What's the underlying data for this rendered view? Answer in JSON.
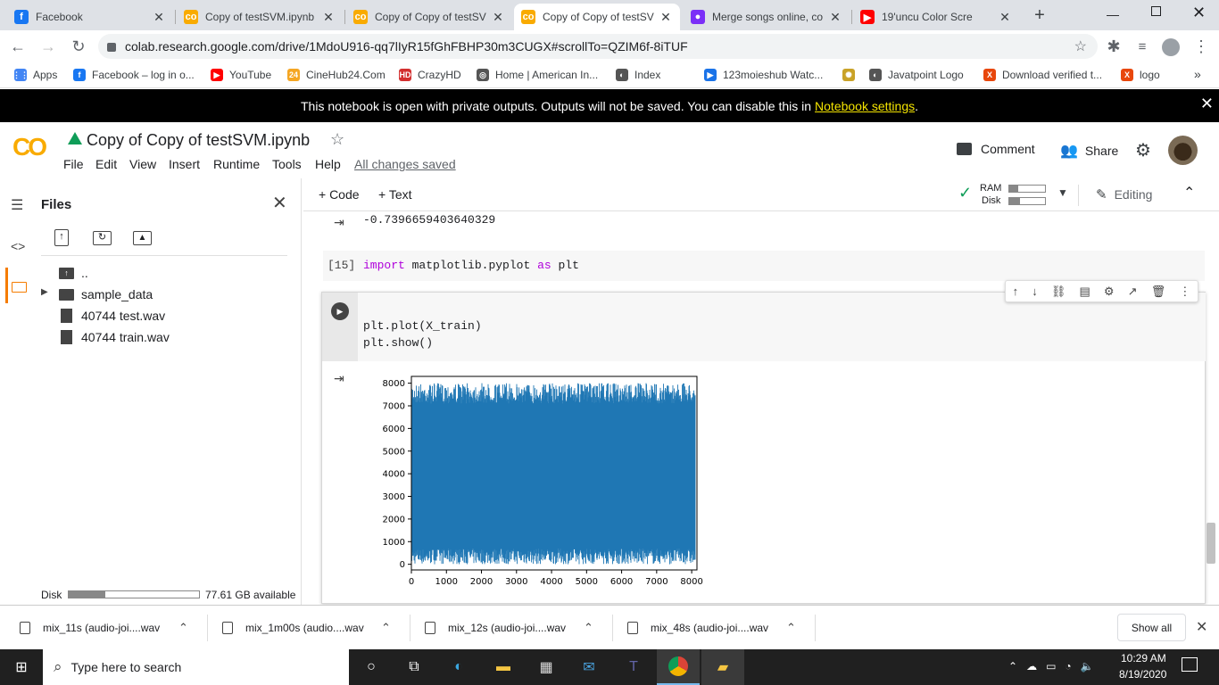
{
  "browser": {
    "tabs": [
      {
        "title": "Facebook",
        "icon": "facebook-icon",
        "color": "#1877f2",
        "glyph": "f"
      },
      {
        "title": "Copy of testSVM.ipynb",
        "icon": "colab-icon",
        "color": "#f9ab00",
        "glyph": "co"
      },
      {
        "title": "Copy of Copy of testSV",
        "icon": "colab-icon",
        "color": "#f9ab00",
        "glyph": "co"
      },
      {
        "title": "Copy of Copy of testSV",
        "icon": "colab-icon",
        "color": "#f9ab00",
        "glyph": "co"
      },
      {
        "title": "Merge songs online, co",
        "icon": "merge-icon",
        "color": "#7b2ff7",
        "glyph": "●"
      },
      {
        "title": "19'uncu Color Scre",
        "icon": "youtube-icon",
        "color": "#ff0000",
        "glyph": "▶"
      }
    ],
    "new_tab": "+",
    "url": "colab.research.google.com/drive/1MdoU916-qq7lIyR15fGhFBHP30m3CUGX#scrollTo=QZIM6f-8iTUF",
    "bookmarks": [
      {
        "label": "Apps",
        "icon": "apps-grid-icon",
        "color": "#4285f4",
        "glyph": "⋮⋮"
      },
      {
        "label": "Facebook – log in o...",
        "icon": "facebook-icon",
        "color": "#1877f2",
        "glyph": "f"
      },
      {
        "label": "YouTube",
        "icon": "youtube-icon",
        "color": "#ff0000",
        "glyph": "▶"
      },
      {
        "label": "CineHub24.Com",
        "icon": "cinehub-icon",
        "color": "#f5a623",
        "glyph": "24"
      },
      {
        "label": "CrazyHD",
        "icon": "crazyhd-icon",
        "color": "#d32f2f",
        "glyph": "HD"
      },
      {
        "label": "Home | American In...",
        "icon": "globe-icon",
        "color": "#555555",
        "glyph": "◎"
      },
      {
        "label": "Index",
        "icon": "globe-icon",
        "color": "#555555",
        "glyph": "◐"
      },
      {
        "label": "123moieshub Watc...",
        "icon": "play-circle-icon",
        "color": "#1a73e8",
        "glyph": "▶"
      },
      {
        "label": "",
        "icon": "emblem-icon",
        "color": "#c9a227",
        "glyph": "✺"
      },
      {
        "label": "Javatpoint Logo",
        "icon": "globe-icon",
        "color": "#555555",
        "glyph": "◐"
      },
      {
        "label": "Download verified t...",
        "icon": "x-logo-icon",
        "color": "#e8470c",
        "glyph": "X"
      },
      {
        "label": "logo",
        "icon": "x-logo-icon",
        "color": "#e8470c",
        "glyph": "X"
      }
    ],
    "more_bookmarks": "»"
  },
  "banner": {
    "text": "This notebook is open with private outputs. Outputs will not be saved. You can disable this in",
    "link": "Notebook settings",
    "tail": "."
  },
  "colab": {
    "logo": "CO",
    "title": "Copy of Copy of testSVM.ipynb",
    "menu": [
      "File",
      "Edit",
      "View",
      "Insert",
      "Runtime",
      "Tools",
      "Help"
    ],
    "save_status": "All changes saved",
    "comment": "Comment",
    "share": "Share",
    "add_code": "+ Code",
    "add_text": "+ Text",
    "ram_label": "RAM",
    "disk_label": "Disk",
    "editing": "Editing"
  },
  "sidebar": {
    "title": "Files",
    "parent": "..",
    "items": [
      {
        "name": "sample_data",
        "type": "folder"
      },
      {
        "name": "40744 test.wav",
        "type": "file"
      },
      {
        "name": "40744 train.wav",
        "type": "file"
      }
    ],
    "disk_label": "Disk",
    "disk_available": "77.61 GB available",
    "disk_used_fraction": 0.28
  },
  "notebook": {
    "prev_output": "-0.7396659403640329",
    "cell15": {
      "prompt": "[15]",
      "kw1": "import",
      "mod": "matplotlib.pyplot",
      "kw2": "as",
      "alias": "plt"
    },
    "cell_active": {
      "line1": "plt.plot(X_train)",
      "line2": "plt.show()"
    }
  },
  "chart_data": {
    "type": "line",
    "color": "#1f77b4",
    "xlim": [
      0,
      8150
    ],
    "ylim": [
      -250,
      8300
    ],
    "xticks": [
      0,
      1000,
      2000,
      3000,
      4000,
      5000,
      6000,
      7000,
      8000
    ],
    "yticks": [
      0,
      1000,
      2000,
      3000,
      4000,
      5000,
      6000,
      7000,
      8000
    ],
    "series_x_range": [
      0,
      8100
    ],
    "series_y_range": [
      0,
      8000
    ]
  },
  "downloads": [
    {
      "name": "mix_11s (audio-joi....wav"
    },
    {
      "name": "mix_1m00s (audio....wav"
    },
    {
      "name": "mix_12s (audio-joi....wav"
    },
    {
      "name": "mix_48s (audio-joi....wav"
    }
  ],
  "show_all": "Show all",
  "taskbar": {
    "search_placeholder": "Type here to search",
    "time": "10:29 AM",
    "date": "8/19/2020"
  }
}
